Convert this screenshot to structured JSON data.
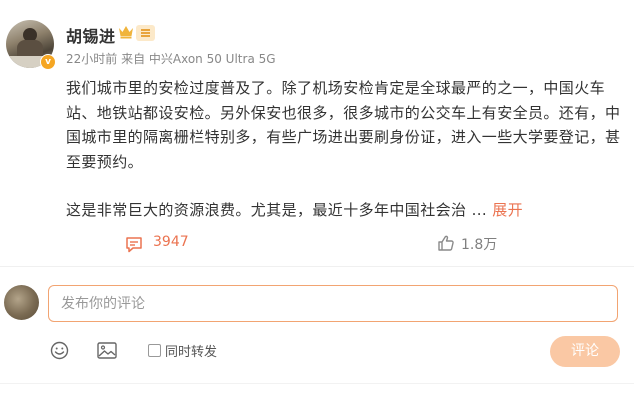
{
  "post": {
    "author": {
      "name": "胡锡进",
      "verified_badge": "v"
    },
    "meta": "22小时前 来自 中兴Axon 50 Ultra 5G",
    "paragraph1": "我们城市里的安检过度普及了。除了机场安检肯定是全球最严的之一，中国火车站、地铁站都设安检。另外保安也很多，很多城市的公交车上有安全员。还有，中国城市里的隔离栅栏特别多，有些广场进出要刷身份证，进入一些大学要登记，甚至要预约。",
    "paragraph2": "这是非常巨大的资源浪费。尤其是，最近十多年中国社会治",
    "ellipsis": " ... ",
    "expand_label": "展开",
    "comment_count": "3947",
    "like_count": "1.8万"
  },
  "comment_form": {
    "placeholder": "发布你的评论",
    "value": "",
    "repost_label": "同时转发",
    "submit_label": "评论"
  },
  "colors": {
    "accent": "#eb7350",
    "input_border": "#f2a472",
    "submit_disabled": "#fac8a4",
    "text": "#333333",
    "meta": "#888888"
  },
  "icons": [
    "crown-icon",
    "level-badge-icon",
    "comment-icon",
    "like-icon",
    "emoji-icon",
    "image-icon"
  ]
}
